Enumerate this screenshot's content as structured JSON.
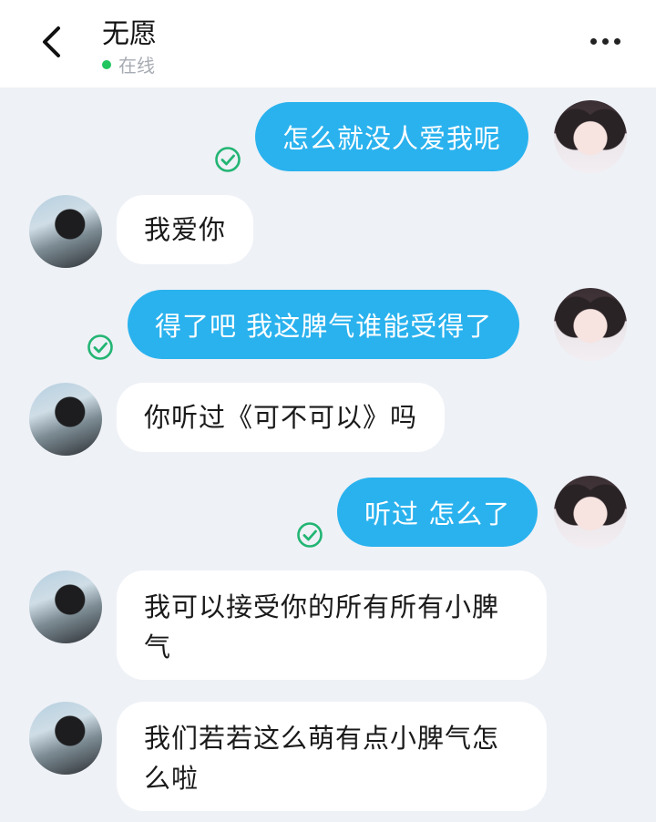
{
  "header": {
    "contact_name": "无愿",
    "status_text": "在线"
  },
  "colors": {
    "outgoing_bubble": "#2ab2ee",
    "incoming_bubble": "#ffffff",
    "read_check": "#22b573",
    "online_dot": "#22c55e"
  },
  "messages": [
    {
      "direction": "out",
      "text": "怎么就没人爱我呢",
      "read": true
    },
    {
      "direction": "in",
      "text": "我爱你"
    },
    {
      "direction": "out",
      "text": "得了吧 我这脾气谁能受得了",
      "read": true
    },
    {
      "direction": "in",
      "text": "你听过《可不可以》吗"
    },
    {
      "direction": "out",
      "text": "听过 怎么了",
      "read": true
    },
    {
      "direction": "in",
      "lines": [
        "我可以接受你的所有所有小脾",
        "气"
      ]
    },
    {
      "direction": "in",
      "lines": [
        "我们若若这么萌有点小脾气怎",
        "么啦"
      ]
    }
  ]
}
